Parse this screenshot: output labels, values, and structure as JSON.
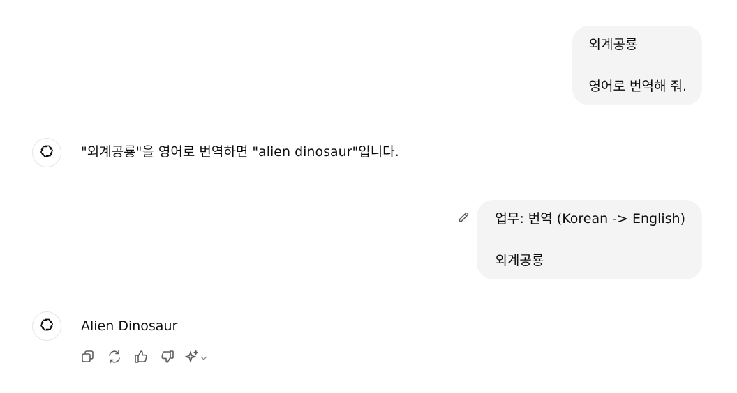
{
  "conversation": {
    "message1": {
      "line1": "외계공룡",
      "line2": "영어로 번역해 줘."
    },
    "response1": {
      "text": "\"외계공룡\"을 영어로 번역하면 \"alien dinosaur\"입니다."
    },
    "message2": {
      "line1": "업무: 번역 (Korean -> English)",
      "line2": "외계공룡"
    },
    "response2": {
      "text": "Alien Dinosaur"
    }
  },
  "icons": {
    "assistant_avatar": "openai-logo-icon",
    "edit": "pencil-icon",
    "copy": "copy-icon",
    "regenerate": "refresh-icon",
    "thumbs_up": "thumbs-up-icon",
    "thumbs_down": "thumbs-down-icon",
    "model_switch": "sparkle-icon",
    "dropdown": "chevron-down-icon"
  },
  "colors": {
    "user_bubble_bg": "#f4f4f4",
    "text": "#0d0d0d",
    "icon": "#5d5d5d"
  }
}
